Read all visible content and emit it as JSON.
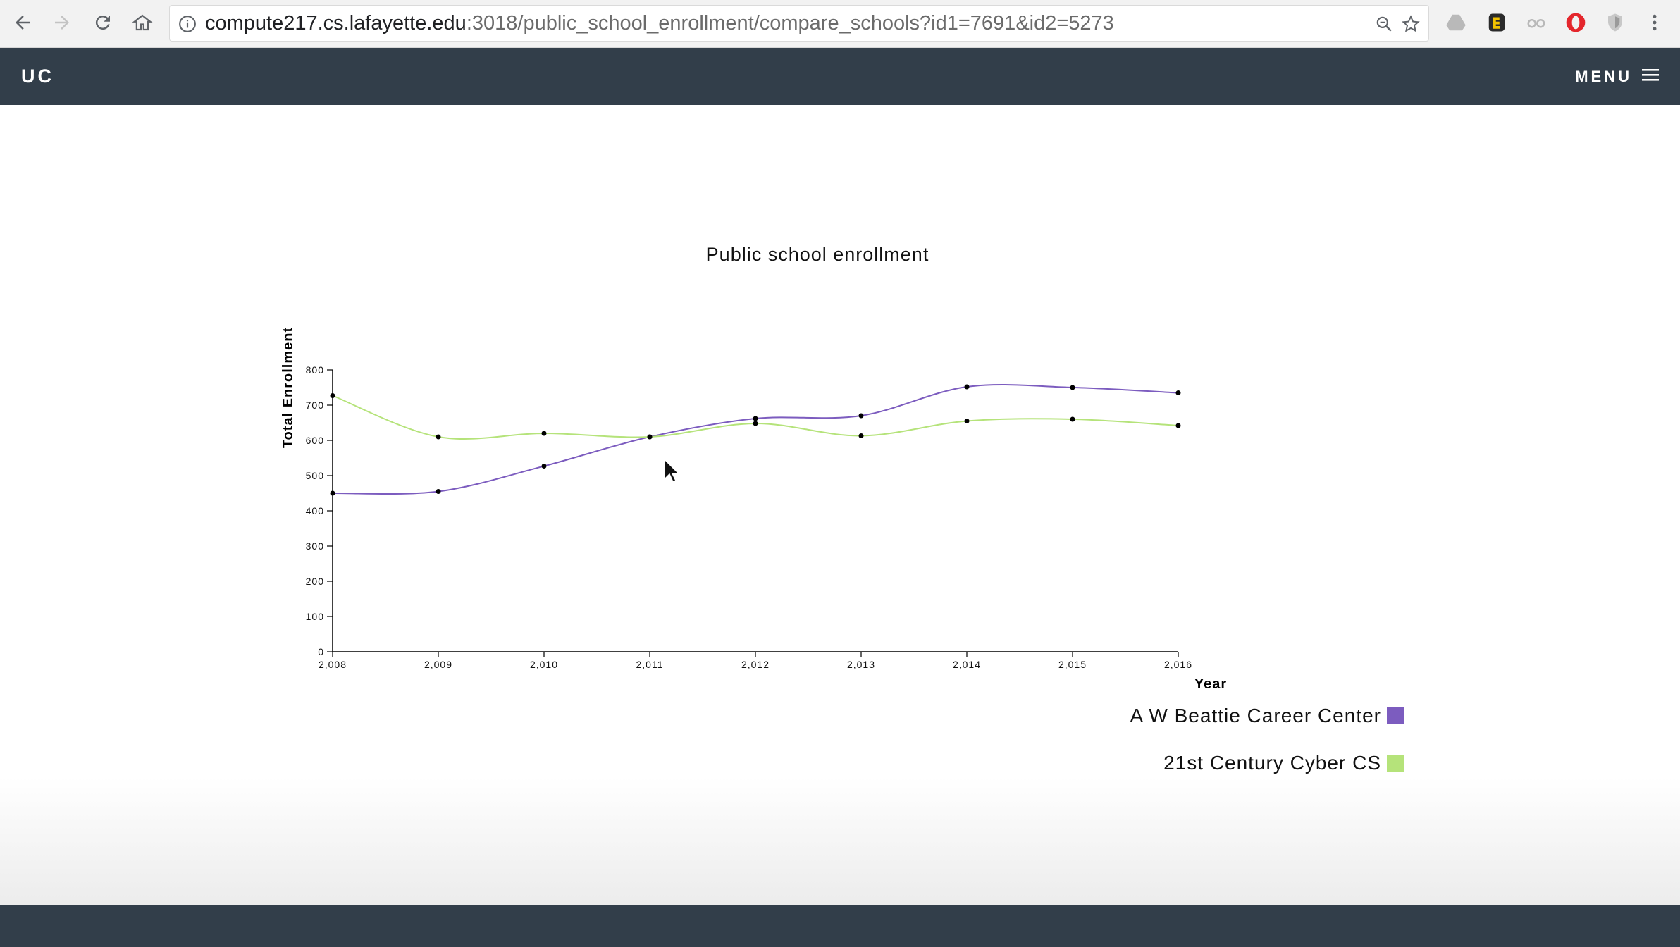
{
  "browser": {
    "url_host": "compute217.cs.lafayette.edu",
    "url_path": ":3018/public_school_enrollment/compare_schools?id1=7691&id2=5273"
  },
  "header": {
    "brand": "UC",
    "menu_label": "MENU"
  },
  "chart_data": {
    "type": "line",
    "title": "Public school enrollment",
    "xlabel": "Year",
    "ylabel": "Total Enrollment",
    "x": [
      2008,
      2009,
      2010,
      2011,
      2012,
      2013,
      2014,
      2015,
      2016
    ],
    "x_tick_labels": [
      "2,008",
      "2,009",
      "2,010",
      "2,011",
      "2,012",
      "2,013",
      "2,014",
      "2,015",
      "2,016"
    ],
    "ylim": [
      0,
      800
    ],
    "y_ticks": [
      0,
      100,
      200,
      300,
      400,
      500,
      600,
      700,
      800
    ],
    "grid": false,
    "legend_position": "bottom-right",
    "series": [
      {
        "name": "A W Beattie Career Center",
        "color": "#7c5cbf",
        "values": [
          450,
          455,
          527,
          610,
          662,
          670,
          752,
          750,
          735
        ]
      },
      {
        "name": "21st Century Cyber CS",
        "color": "#b5e37a",
        "values": [
          727,
          610,
          620,
          610,
          648,
          613,
          655,
          660,
          642
        ]
      }
    ]
  }
}
